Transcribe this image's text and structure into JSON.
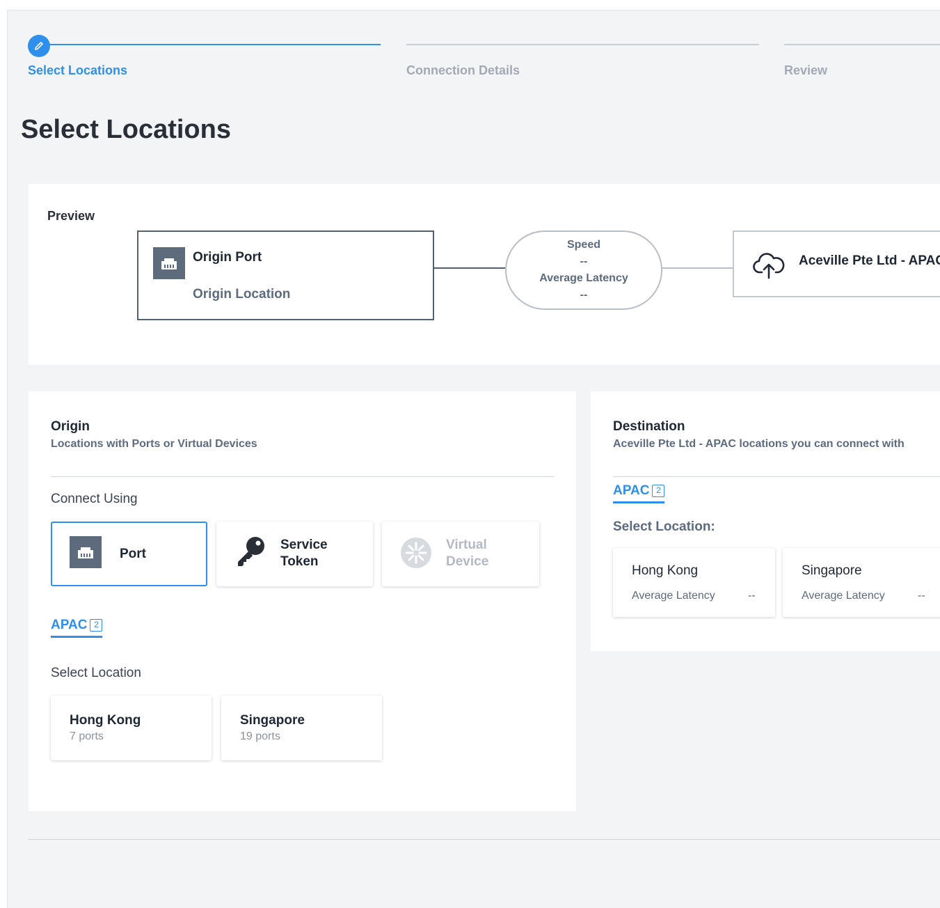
{
  "stepper": {
    "steps": [
      {
        "label": "Select Locations",
        "state": "active",
        "icon": "pencil-icon"
      },
      {
        "label": "Connection Details",
        "state": "upcoming"
      },
      {
        "label": "Review",
        "state": "upcoming"
      }
    ]
  },
  "page": {
    "title": "Select Locations"
  },
  "preview": {
    "label": "Preview",
    "origin": {
      "title": "Origin Port",
      "subtitle": "Origin Location",
      "icon": "ethernet-port-icon"
    },
    "link": {
      "speed_label": "Speed",
      "speed_value": "--",
      "latency_label": "Average Latency",
      "latency_value": "--"
    },
    "destination": {
      "title": "Aceville Pte Ltd - APAC",
      "icon": "cloud-upload-icon"
    }
  },
  "origin": {
    "title": "Origin",
    "subtitle": "Locations with Ports or Virtual Devices",
    "connect_using_label": "Connect Using",
    "options": [
      {
        "label": "Port",
        "icon": "ethernet-port-icon",
        "selected": true
      },
      {
        "label_line1": "Service",
        "label_line2": "Token",
        "icon": "key-icon"
      },
      {
        "label_line1": "Virtual",
        "label_line2": "Device",
        "icon": "virtual-device-icon",
        "disabled": true
      }
    ],
    "region": {
      "name": "APAC",
      "count": "2"
    },
    "select_location_label": "Select Location",
    "locations": [
      {
        "name": "Hong Kong",
        "ports": "7 ports"
      },
      {
        "name": "Singapore",
        "ports": "19 ports"
      }
    ]
  },
  "destination": {
    "title": "Destination",
    "subtitle": "Aceville Pte Ltd - APAC locations you can connect with",
    "region": {
      "name": "APAC",
      "count": "2"
    },
    "select_location_label": "Select Location:",
    "locations": [
      {
        "name": "Hong Kong",
        "metric_label": "Average Latency",
        "metric_value": "--"
      },
      {
        "name": "Singapore",
        "metric_label": "Average Latency",
        "metric_value": "--"
      }
    ]
  },
  "colors": {
    "accent": "#2f8fec",
    "icon_bg": "#5d6b7d",
    "background": "#f3f4f6"
  }
}
